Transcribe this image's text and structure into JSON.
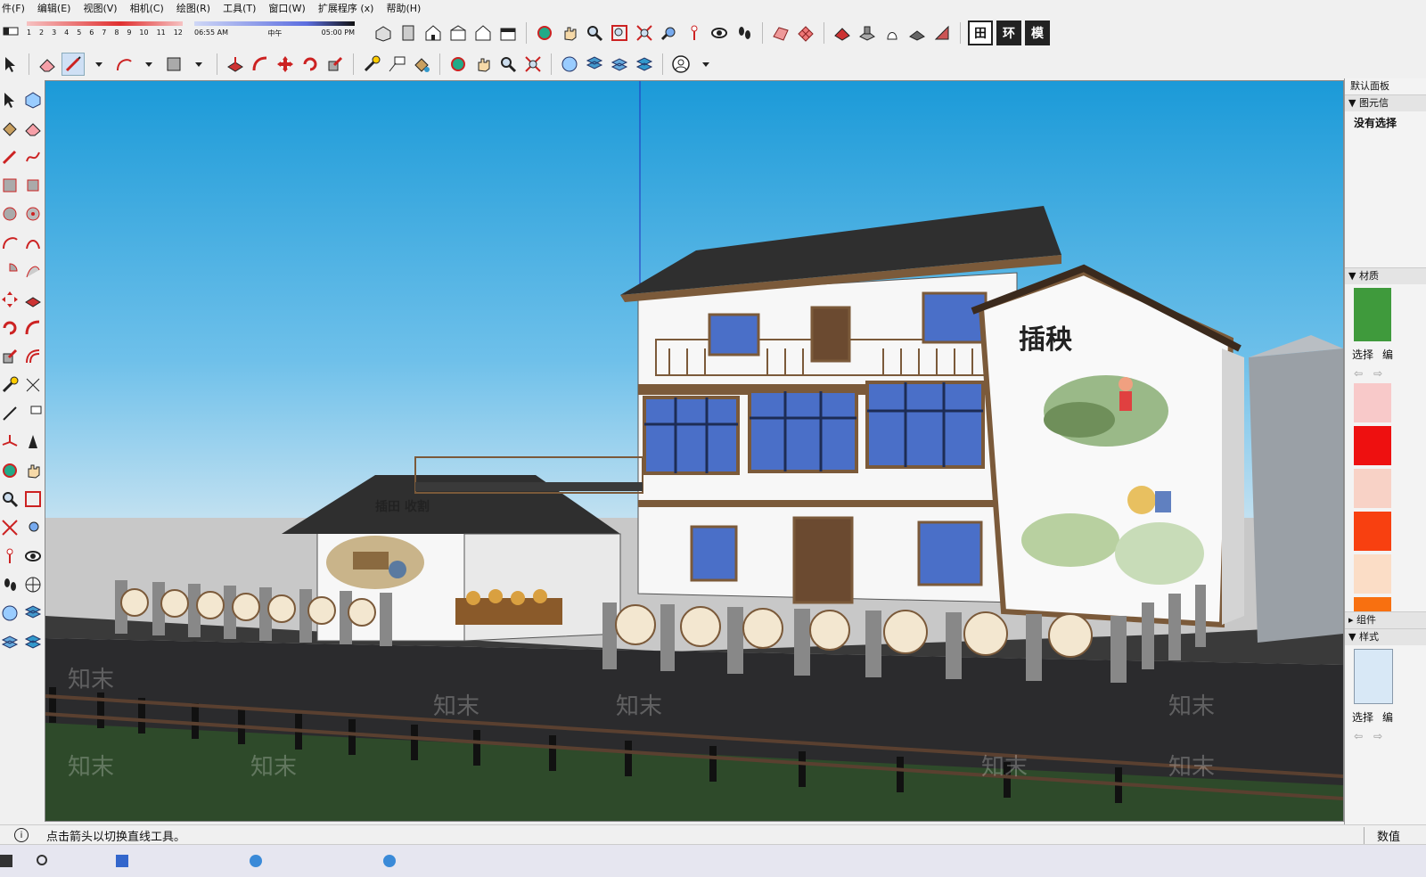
{
  "menu": {
    "items": [
      "件(F)",
      "编辑(E)",
      "视图(V)",
      "相机(C)",
      "绘图(R)",
      "工具(T)",
      "窗口(W)",
      "扩展程序 (x)",
      "帮助(H)"
    ]
  },
  "shadow": {
    "months": [
      "1",
      "2",
      "3",
      "4",
      "5",
      "6",
      "7",
      "8",
      "9",
      "10",
      "11",
      "12"
    ],
    "time_start": "06:55 AM",
    "time_mid": "中午",
    "time_end": "05:00 PM"
  },
  "toolbar": {
    "view_labels": [
      "田",
      "环",
      "模"
    ]
  },
  "model": {
    "sign_main": "插秧",
    "sign_small": "插田 收割",
    "watermark": "知末"
  },
  "tray": {
    "title": "默认面板",
    "entity_info": "图元信",
    "no_selection": "没有选择",
    "materials": "材质",
    "select_tab": "选择",
    "edit_tab": "编",
    "components": "组件",
    "styles": "样式",
    "select_tab_2": "选择",
    "edit_tab_2": "编",
    "material_colors": [
      "#f8c9c9",
      "#ee1010",
      "#f8d2c6",
      "#f84010",
      "#fbddc6",
      "#f87010"
    ],
    "grass_color": "#3f9a3c"
  },
  "status": {
    "info_icon": "i",
    "message": "点击箭头以切换直线工具。",
    "measure_label": "数值"
  },
  "taskbar": {
    "items": [
      "",
      "",
      ""
    ]
  }
}
